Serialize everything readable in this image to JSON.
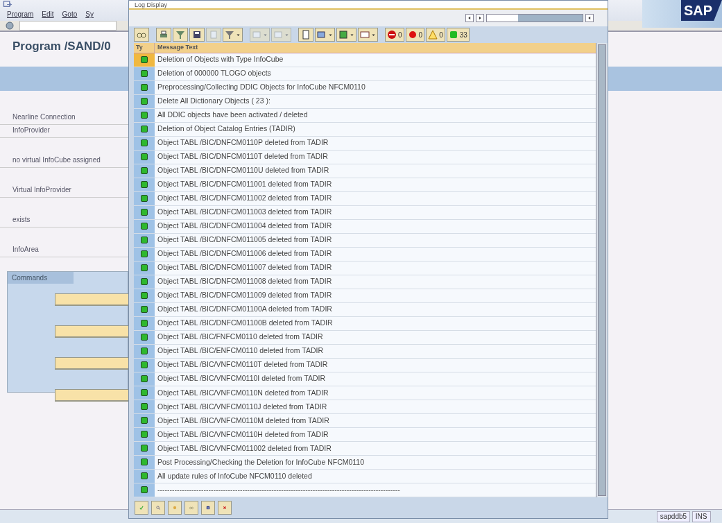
{
  "app": {
    "menu": [
      "Program",
      "Edit",
      "Goto",
      "Sy"
    ],
    "title": "Program /SAND/0",
    "labels": [
      "Nearline Connection",
      "InfoProvider",
      "no virtual InfoCube assigned",
      "Virtual InfoProvider",
      "exists",
      "InfoArea"
    ],
    "group_title": "Commands",
    "logo": "SAP"
  },
  "dialog": {
    "title": "Log Display",
    "counts": [
      {
        "kind": "stop",
        "value": "0"
      },
      {
        "kind": "error",
        "value": "0"
      },
      {
        "kind": "warning",
        "value": "0"
      },
      {
        "kind": "success",
        "value": "33"
      }
    ],
    "columns": [
      "Ty",
      "Message Text"
    ],
    "messages": [
      {
        "color": "#2eb82e",
        "selected": true,
        "text": "Deletion of Objects with Type InfoCube"
      },
      {
        "color": "#2eb82e",
        "selected": false,
        "text": "Deletion of 000000 TLOGO objects"
      },
      {
        "color": "#2eb82e",
        "selected": false,
        "text": "Preprocessing/Collecting DDIC Objects for InfoCube NFCM0110"
      },
      {
        "color": "#2eb82e",
        "selected": false,
        "text": "Delete All Dictionary Objects ( 23 ):"
      },
      {
        "color": "#2eb82e",
        "selected": false,
        "text": "All DDIC objects have been activated / deleted"
      },
      {
        "color": "#2eb82e",
        "selected": false,
        "text": "Deletion of Object Catalog Entries (TADIR)"
      },
      {
        "color": "#2eb82e",
        "selected": false,
        "text": "Object TABL /BIC/DNFCM0110P deleted from TADIR"
      },
      {
        "color": "#2eb82e",
        "selected": false,
        "text": "Object TABL /BIC/DNFCM0110T deleted from TADIR"
      },
      {
        "color": "#2eb82e",
        "selected": false,
        "text": "Object TABL /BIC/DNFCM0110U deleted from TADIR"
      },
      {
        "color": "#2eb82e",
        "selected": false,
        "text": "Object TABL /BIC/DNFCM011001 deleted from TADIR"
      },
      {
        "color": "#2eb82e",
        "selected": false,
        "text": "Object TABL /BIC/DNFCM011002 deleted from TADIR"
      },
      {
        "color": "#2eb82e",
        "selected": false,
        "text": "Object TABL /BIC/DNFCM011003 deleted from TADIR"
      },
      {
        "color": "#2eb82e",
        "selected": false,
        "text": "Object TABL /BIC/DNFCM011004 deleted from TADIR"
      },
      {
        "color": "#2eb82e",
        "selected": false,
        "text": "Object TABL /BIC/DNFCM011005 deleted from TADIR"
      },
      {
        "color": "#2eb82e",
        "selected": false,
        "text": "Object TABL /BIC/DNFCM011006 deleted from TADIR"
      },
      {
        "color": "#2eb82e",
        "selected": false,
        "text": "Object TABL /BIC/DNFCM011007 deleted from TADIR"
      },
      {
        "color": "#2eb82e",
        "selected": false,
        "text": "Object TABL /BIC/DNFCM011008 deleted from TADIR"
      },
      {
        "color": "#2eb82e",
        "selected": false,
        "text": "Object TABL /BIC/DNFCM011009 deleted from TADIR"
      },
      {
        "color": "#2eb82e",
        "selected": false,
        "text": "Object TABL /BIC/DNFCM01100A deleted from TADIR"
      },
      {
        "color": "#2eb82e",
        "selected": false,
        "text": "Object TABL /BIC/DNFCM01100B deleted from TADIR"
      },
      {
        "color": "#2eb82e",
        "selected": false,
        "text": "Object TABL /BIC/FNFCM0110 deleted from TADIR"
      },
      {
        "color": "#2eb82e",
        "selected": false,
        "text": "Object TABL /BIC/ENFCM0110 deleted from TADIR"
      },
      {
        "color": "#2eb82e",
        "selected": false,
        "text": "Object TABL /BIC/VNFCM0110T deleted from TADIR"
      },
      {
        "color": "#2eb82e",
        "selected": false,
        "text": "Object TABL /BIC/VNFCM0110I deleted from TADIR"
      },
      {
        "color": "#2eb82e",
        "selected": false,
        "text": "Object TABL /BIC/VNFCM0110N deleted from TADIR"
      },
      {
        "color": "#2eb82e",
        "selected": false,
        "text": "Object TABL /BIC/VNFCM0110J deleted from TADIR"
      },
      {
        "color": "#2eb82e",
        "selected": false,
        "text": "Object TABL /BIC/VNFCM0110M deleted from TADIR"
      },
      {
        "color": "#2eb82e",
        "selected": false,
        "text": "Object TABL /BIC/VNFCM0110H deleted from TADIR"
      },
      {
        "color": "#2eb82e",
        "selected": false,
        "text": "Object TABL /BIC/VNFCM011002 deleted from TADIR"
      },
      {
        "color": "#2eb82e",
        "selected": false,
        "text": "Post Processing/Checking the Deletion for InfoCube NFCM0110"
      },
      {
        "color": "#2eb82e",
        "selected": false,
        "text": "All update rules of InfoCube NFCM0110 deleted"
      },
      {
        "color": "#2eb82e",
        "selected": false,
        "text": "----------------------------------------------------------------------------------------------------"
      }
    ]
  },
  "status_bar": {
    "system": "sapddb5",
    "mode": "INS"
  }
}
